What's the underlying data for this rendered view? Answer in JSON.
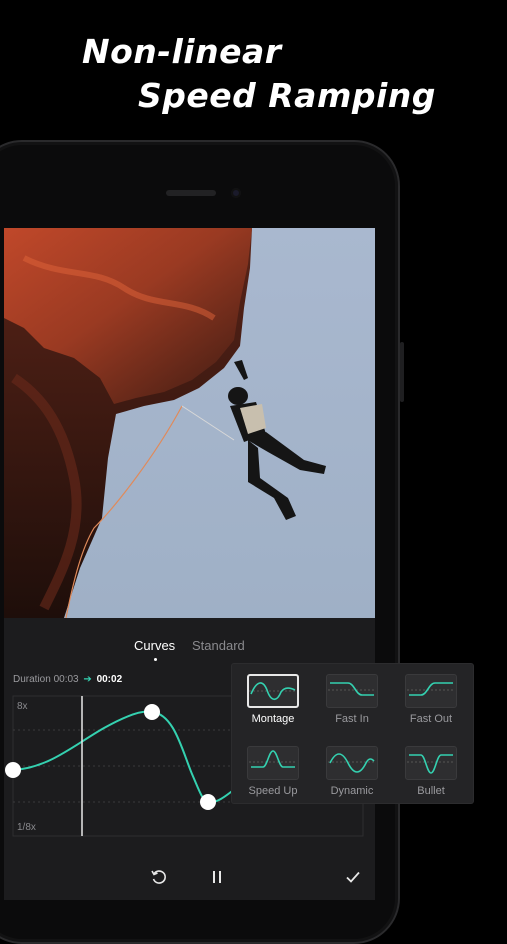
{
  "headline": {
    "line1": "Non-linear",
    "line2": "Speed Ramping"
  },
  "editor": {
    "tabs": [
      {
        "label": "Curves",
        "active": true
      },
      {
        "label": "Standard",
        "active": false
      }
    ],
    "duration": {
      "label": "Duration 00:03",
      "new_value": "00:02"
    },
    "speed_axis": {
      "max_label": "8x",
      "min_label": "1/8x"
    },
    "curve_color": "#34d1b0",
    "controls": [
      "reset-icon",
      "pause-icon",
      "confirm-icon"
    ]
  },
  "presets": [
    {
      "label": "Montage",
      "selected": true
    },
    {
      "label": "Fast In",
      "selected": false
    },
    {
      "label": "Fast Out",
      "selected": false
    },
    {
      "label": "Speed Up",
      "selected": false
    },
    {
      "label": "Dynamic",
      "selected": false
    },
    {
      "label": "Bullet",
      "selected": false
    }
  ],
  "colors": {
    "accent": "#34d1b0",
    "background": "#000000",
    "panel": "#1c1c1e"
  }
}
